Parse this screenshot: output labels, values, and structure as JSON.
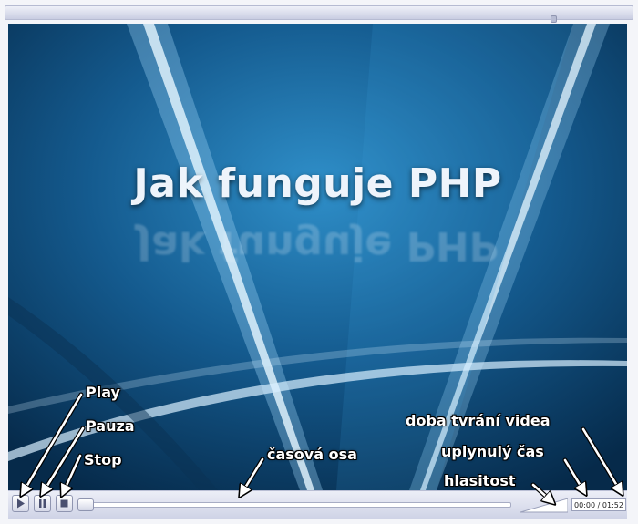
{
  "video": {
    "title": "Jak funguje PHP"
  },
  "controls": {
    "play_icon": "play-icon",
    "pause_icon": "pause-icon",
    "stop_icon": "stop-icon",
    "time_display": "00:00 / 01:52"
  },
  "annotations": {
    "play": "Play",
    "pause": "Pauza",
    "stop": "Stop",
    "timeline": "časová osa",
    "duration": "doba tvrání videa",
    "elapsed": "uplynulý čas",
    "volume": "hlasitost"
  },
  "colors": {
    "video_background": "#0b3b63",
    "annotation_text": "#ffffff",
    "annotation_outline": "#000000"
  }
}
